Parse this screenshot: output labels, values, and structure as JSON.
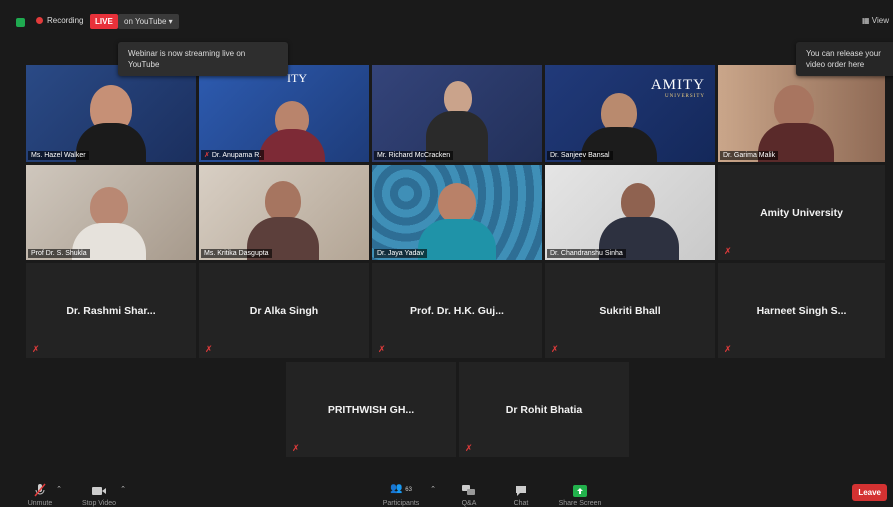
{
  "top": {
    "recording": "Recording",
    "live": "LIVE",
    "youtube": "on YouTube",
    "view": "View"
  },
  "tooltips": {
    "streaming": "Webinar is now streaming live on YouTube",
    "release": "You can release your video order here"
  },
  "row1": [
    {
      "name": "Ms. Hazel Walker"
    },
    {
      "name": "Dr. Anupama R."
    },
    {
      "name": "Mr. Richard McCracken"
    },
    {
      "name": "Dr. Sanjeev Bansal"
    },
    {
      "name": "Dr. Garima Malik"
    }
  ],
  "row2": [
    {
      "name": "Prof Dr. S. Shukla"
    },
    {
      "name": "Ms. Kritika Dasgupta"
    },
    {
      "name": "Dr. Jaya Yadav"
    },
    {
      "name": "Dr. Chandranshu Sinha"
    },
    {
      "name": "Amity University"
    }
  ],
  "row3": [
    {
      "name": "Dr. Rashmi Shar..."
    },
    {
      "name": "Dr Alka Singh"
    },
    {
      "name": "Prof. Dr. H.K. Guj..."
    },
    {
      "name": "Sukriti Bhall"
    },
    {
      "name": "Harneet Singh S..."
    }
  ],
  "row4": [
    {
      "name": "PRITHWISH GH..."
    },
    {
      "name": "Dr Rohit Bhatia"
    }
  ],
  "logo": {
    "title": "AMITY",
    "subtitle": "UNIVERSITY",
    "fragment": "ITY"
  },
  "toolbar": {
    "unmute": "Unmute",
    "stop_video": "Stop Video",
    "participants": "Participants",
    "participants_count": "63",
    "qa": "Q&A",
    "chat": "Chat",
    "share": "Share Screen",
    "leave": "Leave"
  },
  "colors": {
    "live": "#e8313a",
    "active_speaker": "#c7e84a",
    "share": "#22b14c",
    "leave": "#d43232"
  }
}
